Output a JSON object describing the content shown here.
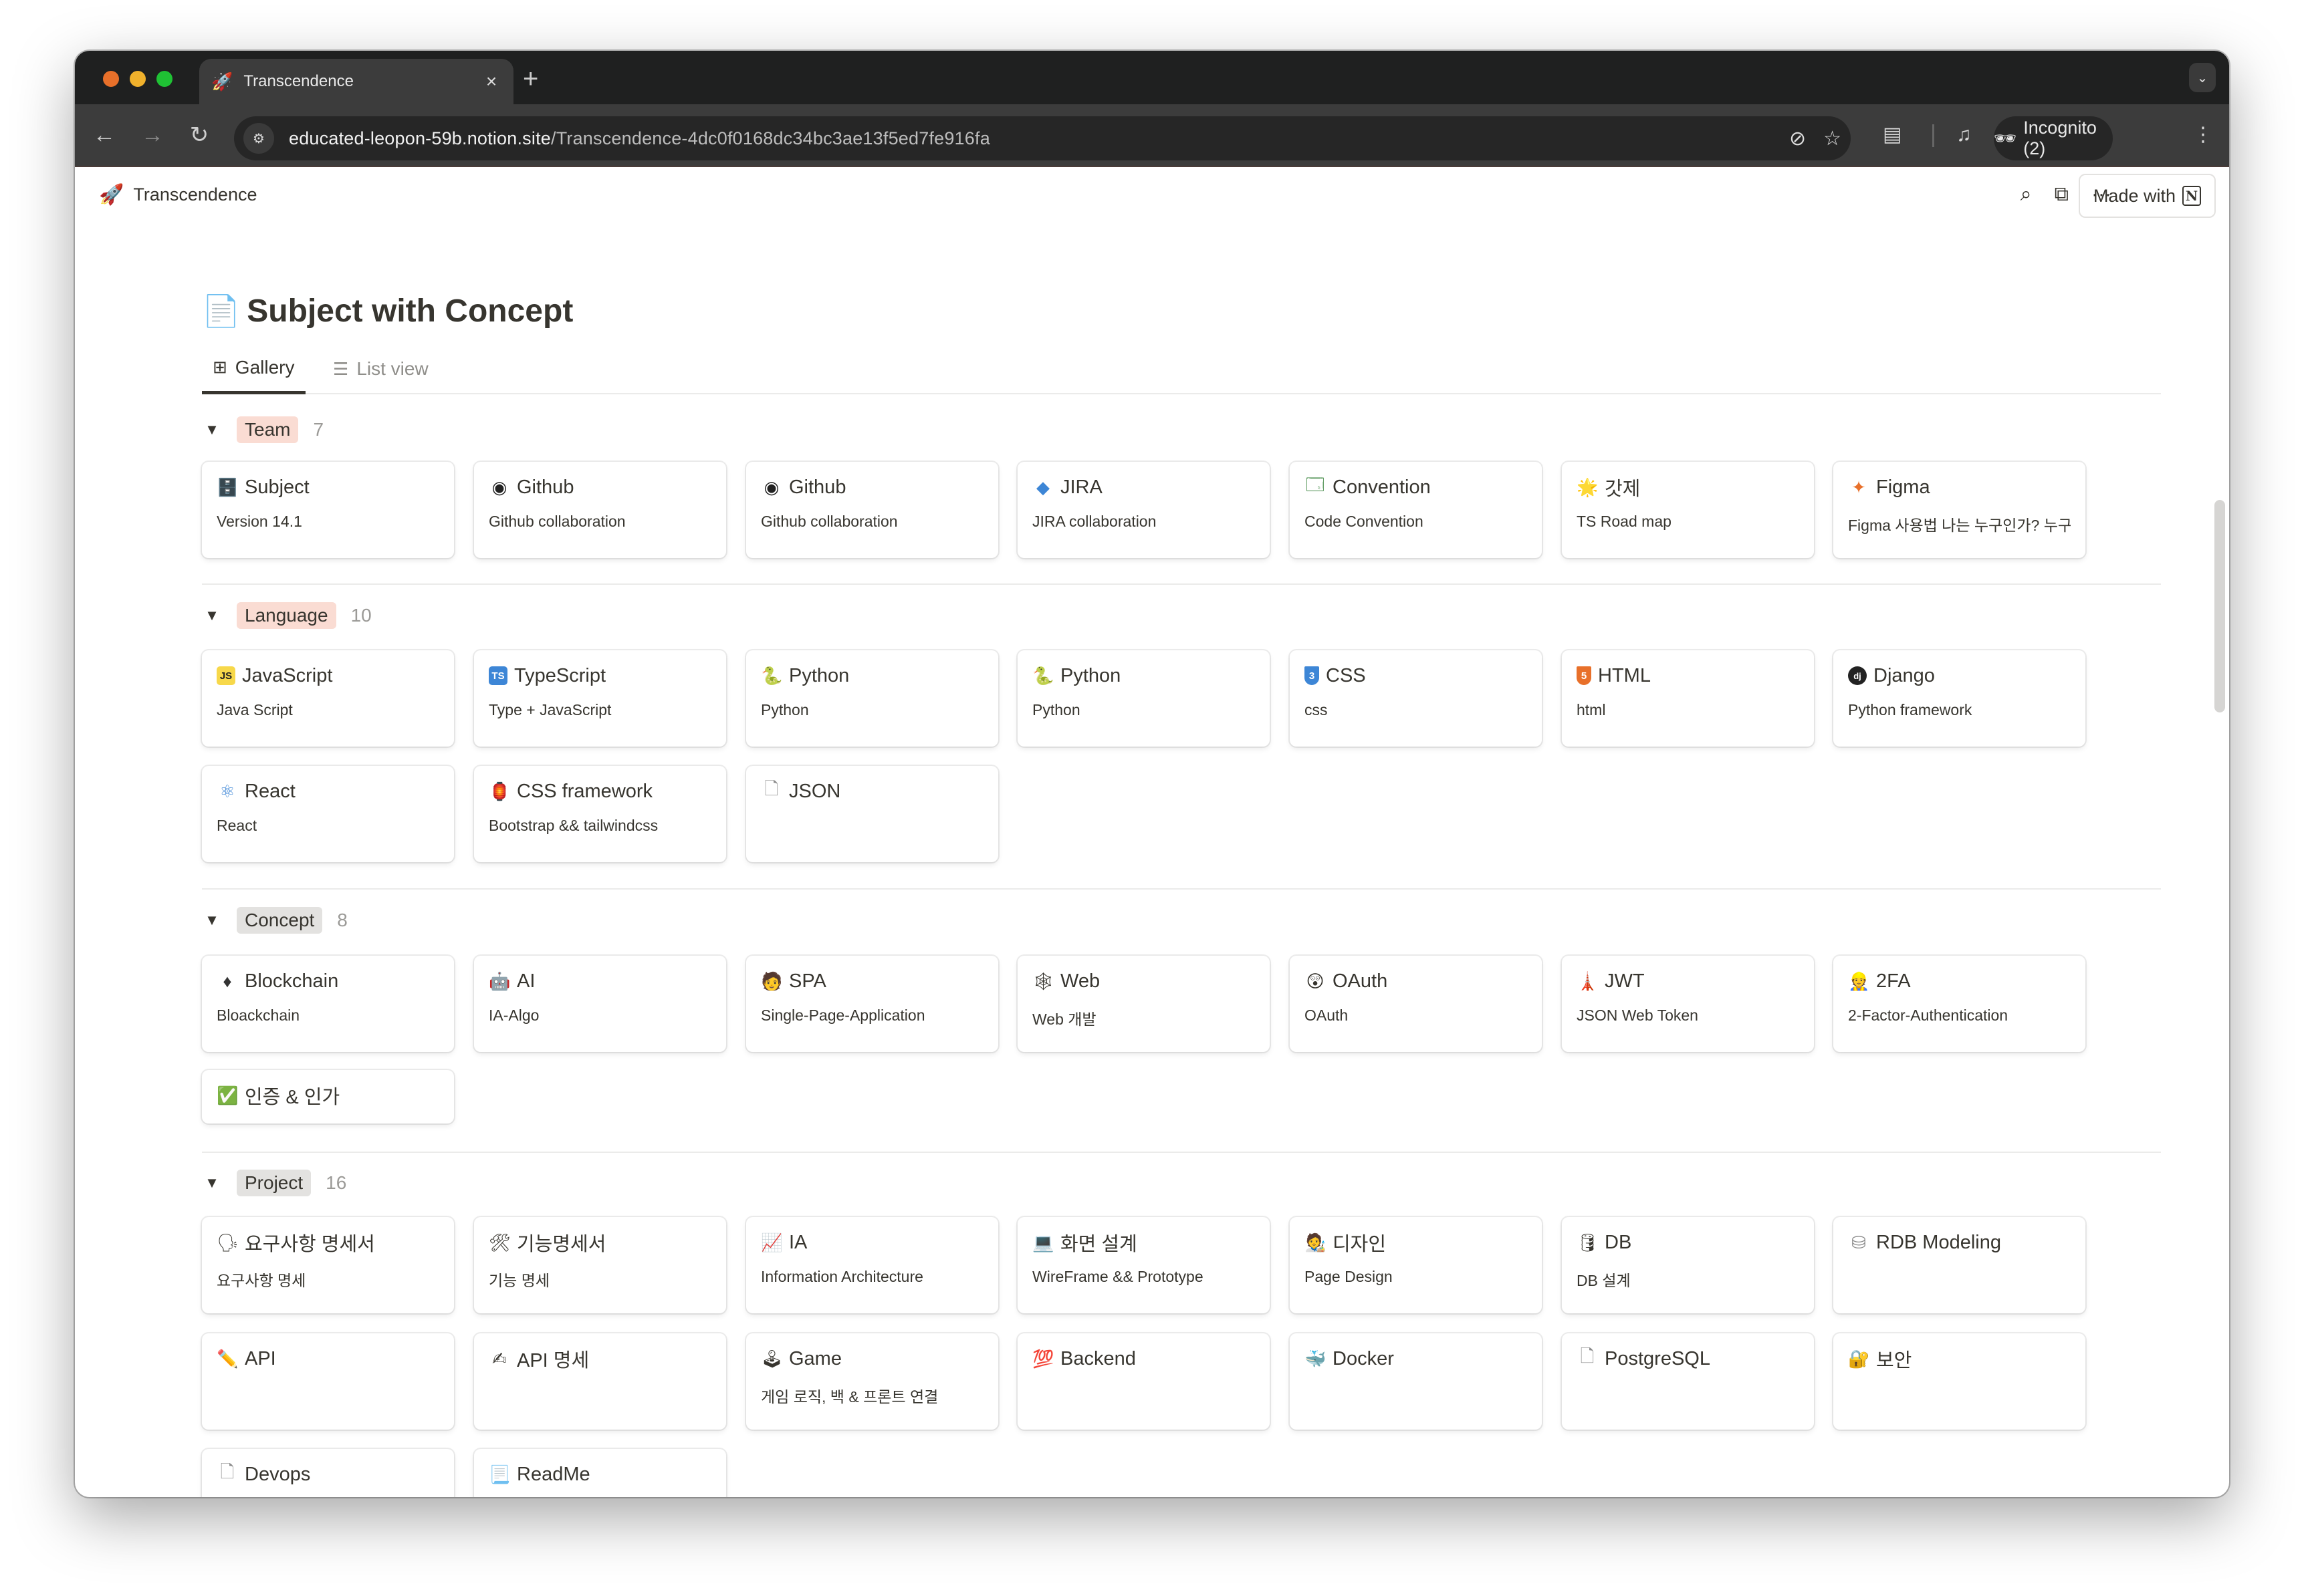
{
  "browser": {
    "tab": {
      "favicon": "rocket-icon",
      "title": "Transcendence",
      "close": "×"
    },
    "new_tab": "+",
    "url_host": "educated-leopon-59b.notion.site",
    "url_path": "/Transcendence-4dc0f0168dc34bc3ae13f5ed7fe916fa",
    "incognito_label": "Incognito (2)"
  },
  "header": {
    "breadcrumb": "Transcendence",
    "made_with": "Made with"
  },
  "page": {
    "title": "Subject with Concept",
    "views": [
      {
        "label": "Gallery",
        "active": true
      },
      {
        "label": "List view",
        "active": false
      }
    ]
  },
  "colors": {
    "tag_team": "#fadcd3",
    "tag_language": "#fadcd3",
    "tag_concept": "#e3e2e0",
    "tag_project": "#e3e2e0"
  },
  "groups": [
    {
      "name": "Team",
      "count": "7",
      "cards": [
        {
          "icon": "🗄️",
          "icon_name": "file-cabinet-icon",
          "title": "Subject",
          "desc": "Version 14.1"
        },
        {
          "icon": "◉",
          "icon_name": "github-icon",
          "title": "Github",
          "desc": "Github collaboration"
        },
        {
          "icon": "◉",
          "icon_name": "github-icon",
          "title": "Github",
          "desc": "Github collaboration"
        },
        {
          "icon": "◆",
          "icon_name": "jira-icon",
          "title": "JIRA",
          "desc": "JIRA collaboration"
        },
        {
          "icon": "🗔",
          "icon_name": "window-icon",
          "title": "Convention",
          "desc": "Code Convention"
        },
        {
          "icon": "🌟",
          "icon_name": "glowing-star-icon",
          "title": "갓제",
          "desc": "TS Road map"
        },
        {
          "icon": "✦",
          "icon_name": "figma-icon",
          "title": "Figma",
          "desc": "Figma 사용법 나는 누구인가? 누구는"
        }
      ]
    },
    {
      "name": "Language",
      "count": "10",
      "cards": [
        {
          "icon": "JS",
          "icon_name": "javascript-icon",
          "title": "JavaScript",
          "desc": "Java Script"
        },
        {
          "icon": "TS",
          "icon_name": "typescript-icon",
          "title": "TypeScript",
          "desc": "Type + JavaScript"
        },
        {
          "icon": "🐍",
          "icon_name": "python-icon",
          "title": "Python",
          "desc": "Python"
        },
        {
          "icon": "🐍",
          "icon_name": "python-icon",
          "title": "Python",
          "desc": "Python"
        },
        {
          "icon": "3",
          "icon_name": "css3-icon",
          "title": "CSS",
          "desc": "css"
        },
        {
          "icon": "5",
          "icon_name": "html5-icon",
          "title": "HTML",
          "desc": "html"
        },
        {
          "icon": "dj",
          "icon_name": "django-icon",
          "title": "Django",
          "desc": "Python framework"
        },
        {
          "icon": "⚛",
          "icon_name": "react-icon",
          "title": "React",
          "desc": "React"
        },
        {
          "icon": "🏮",
          "icon_name": "css-framework-icon",
          "title": "CSS framework",
          "desc": "Bootstrap && tailwindcss"
        },
        {
          "icon": "🗋",
          "icon_name": "page-icon",
          "title": "JSON",
          "desc": ""
        }
      ]
    },
    {
      "name": "Concept",
      "count": "8",
      "cards": [
        {
          "icon": "♦",
          "icon_name": "ethereum-icon",
          "title": "Blockchain",
          "desc": "Bloackchain"
        },
        {
          "icon": "🤖",
          "icon_name": "robot-icon",
          "title": "AI",
          "desc": "IA-Algo"
        },
        {
          "icon": "🧑",
          "icon_name": "person-icon",
          "title": "SPA",
          "desc": "Single-Page-Application"
        },
        {
          "icon": "🕸",
          "icon_name": "spider-web-icon",
          "title": "Web",
          "desc": "Web 개발"
        },
        {
          "icon": "😲",
          "icon_name": "astonished-face-icon",
          "title": "OAuth",
          "desc": "OAuth"
        },
        {
          "icon": "🗼",
          "icon_name": "tower-icon",
          "title": "JWT",
          "desc": "JSON Web Token"
        },
        {
          "icon": "👷",
          "icon_name": "worker-icon",
          "title": "2FA",
          "desc": "2-Factor-Authentication"
        },
        {
          "icon": "✅",
          "icon_name": "check-mark-icon",
          "title": "인증 & 인가",
          "desc": ""
        }
      ]
    },
    {
      "name": "Project",
      "count": "16",
      "cards": [
        {
          "icon": "🗣",
          "icon_name": "speaking-head-icon",
          "title": "요구사항 명세서",
          "desc": "요구사항 명세"
        },
        {
          "icon": "🛠",
          "icon_name": "tools-icon",
          "title": "기능명세서",
          "desc": "기능 명세"
        },
        {
          "icon": "📈",
          "icon_name": "chart-icon",
          "title": "IA",
          "desc": "Information Architecture"
        },
        {
          "icon": "💻",
          "icon_name": "laptop-icon",
          "title": "화면 설계",
          "desc": "WireFrame && Prototype"
        },
        {
          "icon": "🧑‍🎨",
          "icon_name": "artist-icon",
          "title": "디자인",
          "desc": "Page Design"
        },
        {
          "icon": "🛢",
          "icon_name": "database-icon",
          "title": "DB",
          "desc": "DB 설계"
        },
        {
          "icon": "⛁",
          "icon_name": "database-outline-icon",
          "title": "RDB Modeling",
          "desc": ""
        },
        {
          "icon": "✏️",
          "icon_name": "pencil-icon",
          "title": "API",
          "desc": ""
        },
        {
          "icon": "✍",
          "icon_name": "writing-hand-icon",
          "title": "API 명세",
          "desc": ""
        },
        {
          "icon": "🕹",
          "icon_name": "joystick-icon",
          "title": "Game",
          "desc": "게임 로직, 백 & 프론트 연결"
        },
        {
          "icon": "💯",
          "icon_name": "hundred-points-icon",
          "title": "Backend",
          "desc": ""
        },
        {
          "icon": "🐳",
          "icon_name": "docker-icon",
          "title": "Docker",
          "desc": ""
        },
        {
          "icon": "🗋",
          "icon_name": "page-icon",
          "title": "PostgreSQL",
          "desc": ""
        },
        {
          "icon": "🔐",
          "icon_name": "lock-with-key-icon",
          "title": "보안",
          "desc": ""
        },
        {
          "icon": "🗋",
          "icon_name": "page-icon",
          "title": "Devops",
          "desc": ""
        },
        {
          "icon": "📃",
          "icon_name": "page-curl-icon",
          "title": "ReadMe",
          "desc": ""
        }
      ]
    }
  ]
}
